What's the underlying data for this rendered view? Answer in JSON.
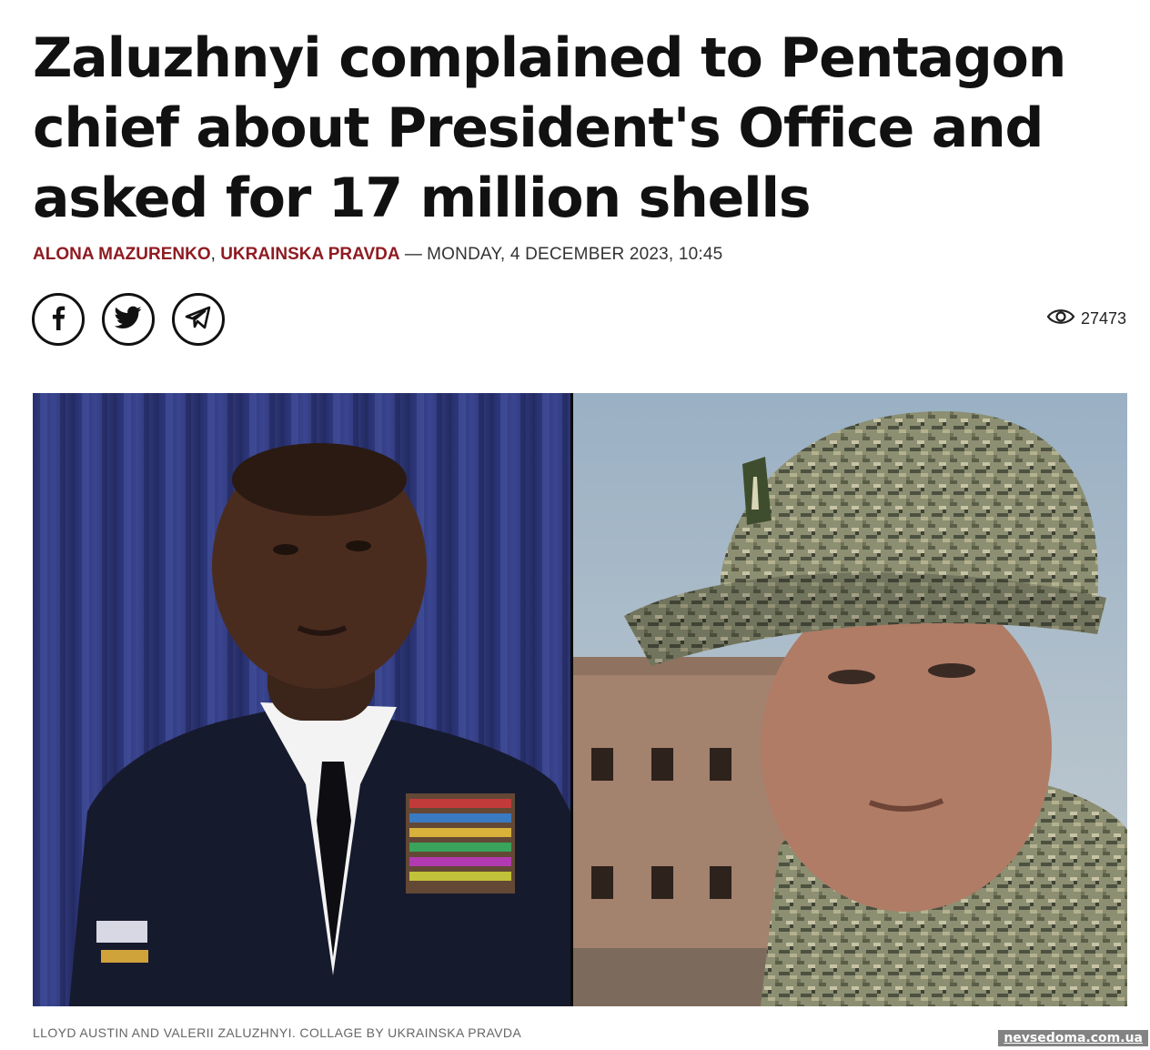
{
  "article": {
    "title": "Zaluzhnyi complained to Pentagon chief about President's Office and asked for 17 million shells",
    "author": "ALONA MAZURENKO",
    "comma": ",",
    "publisher": "UKRAINSKA PRAVDA",
    "separator": " — ",
    "date": "MONDAY, 4 DECEMBER 2023, 10:45",
    "accent_color": "#8f1b22"
  },
  "share": {
    "buttons": [
      {
        "icon": "facebook-icon"
      },
      {
        "icon": "twitter-icon"
      },
      {
        "icon": "telegram-icon"
      }
    ]
  },
  "views": {
    "icon": "eye-icon",
    "count": "27473"
  },
  "photo": {
    "caption": "LLOYD AUSTIN AND VALERII ZALUZHNYI. COLLAGE BY UKRAINSKA PRAVDA"
  },
  "watermark": "nevsedoma.com.ua"
}
